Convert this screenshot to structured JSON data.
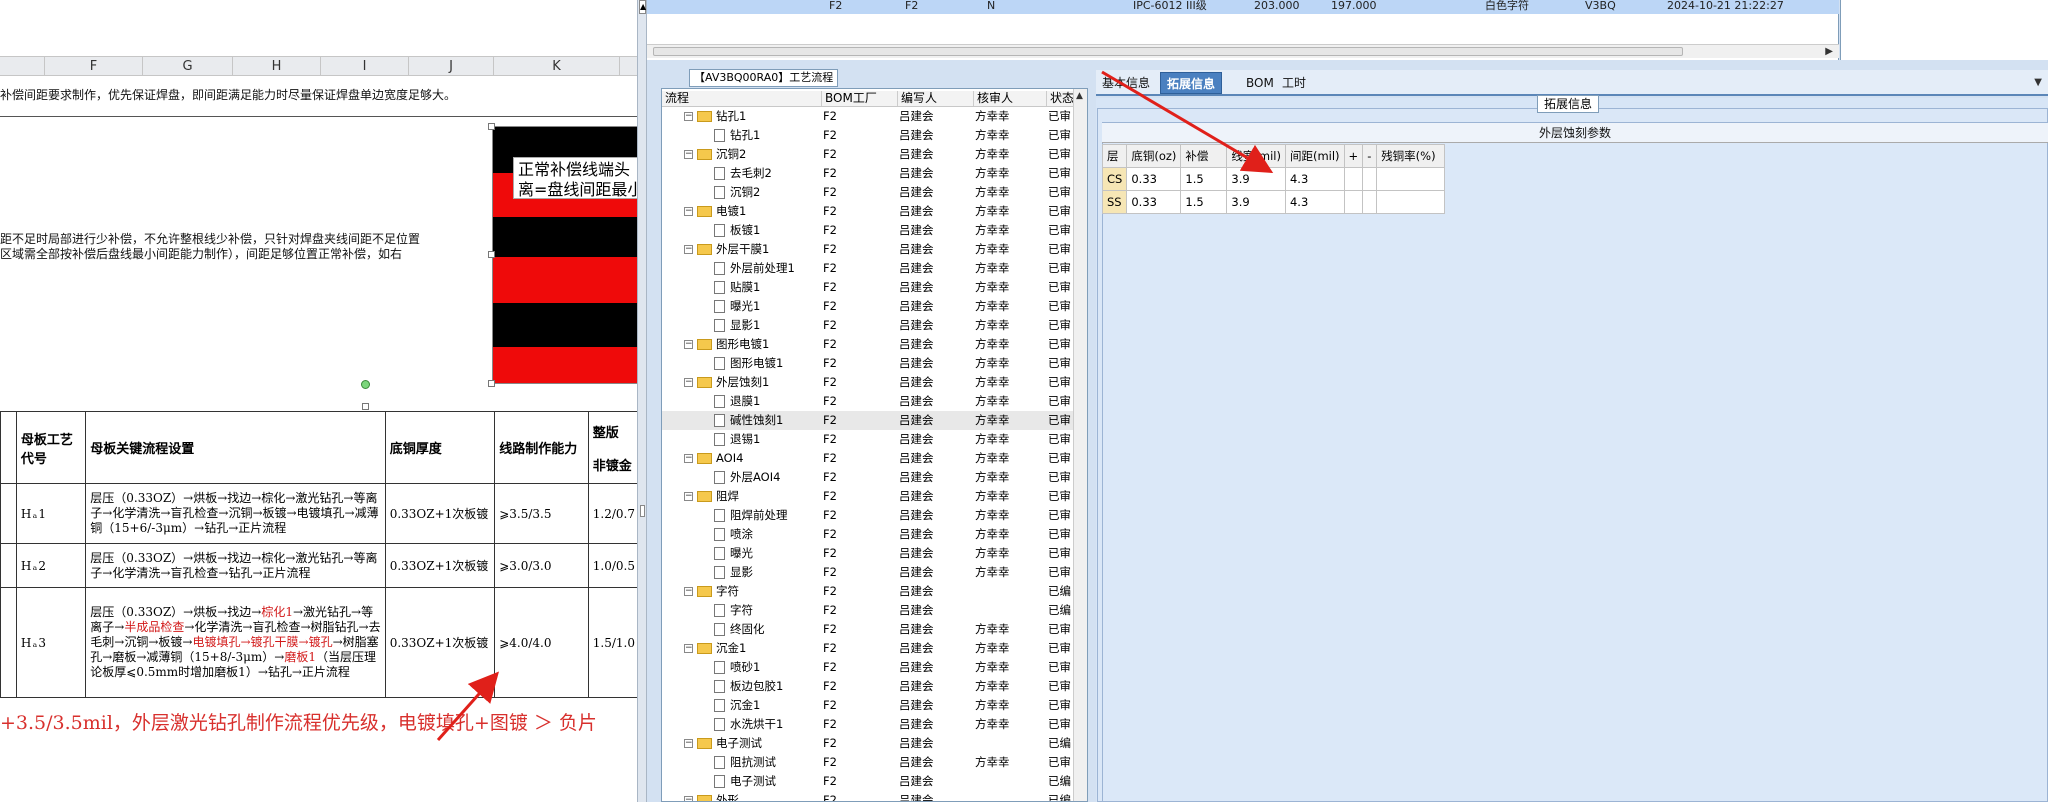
{
  "sheet": {
    "columns": [
      "F",
      "G",
      "H",
      "I",
      "J",
      "K"
    ],
    "lines": {
      "top_note": "补偿间距要求制作，优先保证焊盘，即间距满足能力时尽量保证焊盘单边宽度足够大。",
      "mid_note_1": "距不足时局部进行少补偿，不允许整根线少补偿，只针对焊盘夹线间距不足位置",
      "mid_note_2": "区域需全部按补偿后盘线最小间距能力制作），间距足够位置正常补偿，如右"
    },
    "picture_callout": "正常补偿线端头\n离=盘线间距最小",
    "table": {
      "headers": {
        "process_code": "母板工艺代号",
        "key_flow": "母板关键流程设置",
        "base_copper": "底铜厚度",
        "line_capability": "线路制作能力",
        "partial_right": "整版",
        "partial_right_sub": "非镀金"
      },
      "rows": [
        {
          "code": "H ₐ 1",
          "flow_parts": [
            {
              "t": "层压（0.33OZ）→烘板→找边→棕化→激光钻孔→等离子→化学清洗→盲孔检查→沉铜→板镀→电镀填孔→减薄铜（15+6/-3μm）→钻孔→正片流程",
              "red": false
            }
          ],
          "base": "0.33OZ+1次板镀",
          "cap": "⩾3.5/3.5",
          "right": "1.2/0.7"
        },
        {
          "code": "H ₐ 2",
          "flow_parts": [
            {
              "t": "层压（0.33OZ）→烘板→找边→棕化→激光钻孔→等离子→化学清洗→盲孔检查→钻孔→正片流程",
              "red": false
            }
          ],
          "base": "0.33OZ+1次板镀",
          "cap": "⩾3.0/3.0",
          "right": "1.0/0.5"
        },
        {
          "code": "H ₐ 3",
          "flow_parts": [
            {
              "t": "层压（0.33OZ）→烘板→找边→",
              "red": false
            },
            {
              "t": "棕化1",
              "red": true
            },
            {
              "t": "→激光钻孔→等离子→",
              "red": false
            },
            {
              "t": "半成品检查",
              "red": true
            },
            {
              "t": "→化学清洗→盲孔检查→树脂钻孔→去毛刺→沉铜→板镀→",
              "red": false
            },
            {
              "t": "电镀填孔→镀孔干膜→镀孔",
              "red": true
            },
            {
              "t": "→树脂塞孔→磨板→减薄铜（15+8/-3μm）→",
              "red": false
            },
            {
              "t": "磨板1",
              "red": true
            },
            {
              "t": "（当层压理论板厚⩽0.5mm时增加磨板1）→钻孔→正片流程",
              "red": false
            }
          ],
          "base": "0.33OZ+1次板镀",
          "cap": "⩾4.0/4.0",
          "right": "1.5/1.0"
        }
      ]
    },
    "bottom_note": "+3.5/3.5mil，外层激光钻孔制作流程优先级，电镀填孔+图镀 ＞ 负片"
  },
  "app": {
    "top_row": {
      "c1": "F2",
      "c2": "F2",
      "c3": "N",
      "c4": "IPC-6012 III级",
      "c5": "203.000",
      "c6": "197.000",
      "c7": "白色字符",
      "c8": "V3BQ",
      "c9": "2024-10-21 21:22:27"
    },
    "panel_title": "【AV3BQ00RA0】工艺流程",
    "tree_headers": [
      "流程",
      "BOM工厂",
      "编写人",
      "核审人",
      "状态"
    ],
    "tree_rows": [
      {
        "lvl": 1,
        "type": "folder",
        "name": "钻孔1",
        "bom": "F2",
        "writer": "吕建会",
        "reviewer": "方幸幸",
        "status": "已审"
      },
      {
        "lvl": 2,
        "type": "doc",
        "name": "钻孔1",
        "bom": "F2",
        "writer": "吕建会",
        "reviewer": "方幸幸",
        "status": "已审"
      },
      {
        "lvl": 1,
        "type": "folder",
        "name": "沉铜2",
        "bom": "F2",
        "writer": "吕建会",
        "reviewer": "方幸幸",
        "status": "已审"
      },
      {
        "lvl": 2,
        "type": "doc",
        "name": "去毛刺2",
        "bom": "F2",
        "writer": "吕建会",
        "reviewer": "方幸幸",
        "status": "已审"
      },
      {
        "lvl": 2,
        "type": "doc",
        "name": "沉铜2",
        "bom": "F2",
        "writer": "吕建会",
        "reviewer": "方幸幸",
        "status": "已审"
      },
      {
        "lvl": 1,
        "type": "folder",
        "name": "电镀1",
        "bom": "F2",
        "writer": "吕建会",
        "reviewer": "方幸幸",
        "status": "已审"
      },
      {
        "lvl": 2,
        "type": "doc",
        "name": "板镀1",
        "bom": "F2",
        "writer": "吕建会",
        "reviewer": "方幸幸",
        "status": "已审"
      },
      {
        "lvl": 1,
        "type": "folder",
        "name": "外层干膜1",
        "bom": "F2",
        "writer": "吕建会",
        "reviewer": "方幸幸",
        "status": "已审"
      },
      {
        "lvl": 2,
        "type": "doc",
        "name": "外层前处理1",
        "bom": "F2",
        "writer": "吕建会",
        "reviewer": "方幸幸",
        "status": "已审"
      },
      {
        "lvl": 2,
        "type": "doc",
        "name": "贴膜1",
        "bom": "F2",
        "writer": "吕建会",
        "reviewer": "方幸幸",
        "status": "已审"
      },
      {
        "lvl": 2,
        "type": "doc",
        "name": "曝光1",
        "bom": "F2",
        "writer": "吕建会",
        "reviewer": "方幸幸",
        "status": "已审"
      },
      {
        "lvl": 2,
        "type": "doc",
        "name": "显影1",
        "bom": "F2",
        "writer": "吕建会",
        "reviewer": "方幸幸",
        "status": "已审"
      },
      {
        "lvl": 1,
        "type": "folder",
        "name": "图形电镀1",
        "bom": "F2",
        "writer": "吕建会",
        "reviewer": "方幸幸",
        "status": "已审"
      },
      {
        "lvl": 2,
        "type": "doc",
        "name": "图形电镀1",
        "bom": "F2",
        "writer": "吕建会",
        "reviewer": "方幸幸",
        "status": "已审"
      },
      {
        "lvl": 1,
        "type": "folder",
        "name": "外层蚀刻1",
        "bom": "F2",
        "writer": "吕建会",
        "reviewer": "方幸幸",
        "status": "已审"
      },
      {
        "lvl": 2,
        "type": "doc",
        "name": "退膜1",
        "bom": "F2",
        "writer": "吕建会",
        "reviewer": "方幸幸",
        "status": "已审"
      },
      {
        "lvl": 2,
        "type": "doc",
        "name": "碱性蚀刻1",
        "bom": "F2",
        "writer": "吕建会",
        "reviewer": "方幸幸",
        "status": "已审",
        "selected": true
      },
      {
        "lvl": 2,
        "type": "doc",
        "name": "退锡1",
        "bom": "F2",
        "writer": "吕建会",
        "reviewer": "方幸幸",
        "status": "已审"
      },
      {
        "lvl": 1,
        "type": "folder",
        "name": "AOI4",
        "bom": "F2",
        "writer": "吕建会",
        "reviewer": "方幸幸",
        "status": "已审"
      },
      {
        "lvl": 2,
        "type": "doc",
        "name": "外层AOI4",
        "bom": "F2",
        "writer": "吕建会",
        "reviewer": "方幸幸",
        "status": "已审"
      },
      {
        "lvl": 1,
        "type": "folder",
        "name": "阻焊",
        "bom": "F2",
        "writer": "吕建会",
        "reviewer": "方幸幸",
        "status": "已审"
      },
      {
        "lvl": 2,
        "type": "doc",
        "name": "阻焊前处理",
        "bom": "F2",
        "writer": "吕建会",
        "reviewer": "方幸幸",
        "status": "已审"
      },
      {
        "lvl": 2,
        "type": "doc",
        "name": "喷涂",
        "bom": "F2",
        "writer": "吕建会",
        "reviewer": "方幸幸",
        "status": "已审"
      },
      {
        "lvl": 2,
        "type": "doc",
        "name": "曝光",
        "bom": "F2",
        "writer": "吕建会",
        "reviewer": "方幸幸",
        "status": "已审"
      },
      {
        "lvl": 2,
        "type": "doc",
        "name": "显影",
        "bom": "F2",
        "writer": "吕建会",
        "reviewer": "方幸幸",
        "status": "已审"
      },
      {
        "lvl": 1,
        "type": "folder",
        "name": "字符",
        "bom": "F2",
        "writer": "吕建会",
        "reviewer": "",
        "status": "已编"
      },
      {
        "lvl": 2,
        "type": "doc",
        "name": "字符",
        "bom": "F2",
        "writer": "吕建会",
        "reviewer": "",
        "status": "已编"
      },
      {
        "lvl": 2,
        "type": "doc",
        "name": "终固化",
        "bom": "F2",
        "writer": "吕建会",
        "reviewer": "方幸幸",
        "status": "已审"
      },
      {
        "lvl": 1,
        "type": "folder",
        "name": "沉金1",
        "bom": "F2",
        "writer": "吕建会",
        "reviewer": "方幸幸",
        "status": "已审"
      },
      {
        "lvl": 2,
        "type": "doc",
        "name": "喷砂1",
        "bom": "F2",
        "writer": "吕建会",
        "reviewer": "方幸幸",
        "status": "已审"
      },
      {
        "lvl": 2,
        "type": "doc",
        "name": "板边包胶1",
        "bom": "F2",
        "writer": "吕建会",
        "reviewer": "方幸幸",
        "status": "已审"
      },
      {
        "lvl": 2,
        "type": "doc",
        "name": "沉金1",
        "bom": "F2",
        "writer": "吕建会",
        "reviewer": "方幸幸",
        "status": "已审"
      },
      {
        "lvl": 2,
        "type": "doc",
        "name": "水洗烘干1",
        "bom": "F2",
        "writer": "吕建会",
        "reviewer": "方幸幸",
        "status": "已审"
      },
      {
        "lvl": 1,
        "type": "folder",
        "name": "电子测试",
        "bom": "F2",
        "writer": "吕建会",
        "reviewer": "",
        "status": "已编"
      },
      {
        "lvl": 2,
        "type": "doc",
        "name": "阻抗测试",
        "bom": "F2",
        "writer": "吕建会",
        "reviewer": "方幸幸",
        "status": "已审"
      },
      {
        "lvl": 2,
        "type": "doc",
        "name": "电子测试",
        "bom": "F2",
        "writer": "吕建会",
        "reviewer": "",
        "status": "已编"
      },
      {
        "lvl": 1,
        "type": "folder",
        "name": "外形",
        "bom": "F2",
        "writer": "吕建会",
        "reviewer": "",
        "status": "已编"
      }
    ],
    "tabs": [
      "基本信息",
      "拓展信息",
      "BOM",
      "工时"
    ],
    "active_tab": 1,
    "ext_label": "拓展信息",
    "etch_title": "外层蚀刻参数",
    "etch_headers": [
      "层",
      "底铜(oz)",
      "补偿",
      "线宽(mil)",
      "间距(mil)",
      "+",
      "-",
      "残铜率(%)"
    ],
    "etch_rows": [
      [
        "CS",
        "0.33",
        "1.5",
        "3.9",
        "4.3",
        "",
        "",
        ""
      ],
      [
        "SS",
        "0.33",
        "1.5",
        "3.9",
        "4.3",
        "",
        "",
        ""
      ]
    ],
    "colors": {
      "annotation_arrow": "#e0201a",
      "active_tab": "#4a80c0",
      "selected_row": "#bcd6f6"
    }
  }
}
